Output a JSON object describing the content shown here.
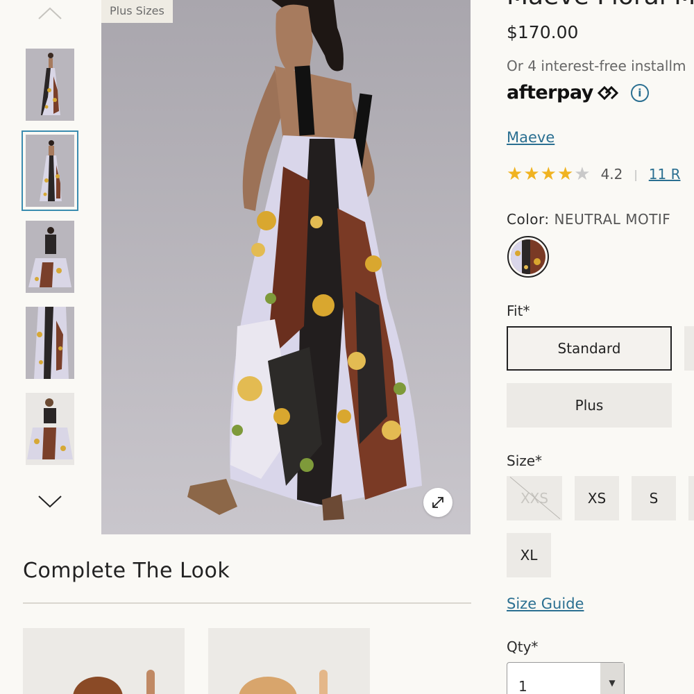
{
  "gallery": {
    "badge": "Plus Sizes",
    "selected_index": 1
  },
  "complete_the_look": {
    "title": "Complete The Look"
  },
  "product": {
    "title": "Maeve Floral M",
    "price": "$170.00",
    "installments_text": "Or 4 interest-free installm",
    "afterpay_logo": "afterpay",
    "brand": "Maeve",
    "rating": {
      "value": "4.2",
      "stars": 4.2,
      "reviews": "11 R"
    },
    "color": {
      "label": "Color:",
      "value": "NEUTRAL MOTIF"
    },
    "fit": {
      "label": "Fit*",
      "options": [
        "Standard",
        "Plus"
      ],
      "selected": "Standard"
    },
    "size": {
      "label": "Size*",
      "options": [
        "XXS",
        "XS",
        "S",
        "XL"
      ],
      "unavailable": [
        "XXS"
      ]
    },
    "size_guide": "Size Guide",
    "qty": {
      "label": "Qty*",
      "value": "1"
    }
  },
  "colors": {
    "link": "#2a6f91",
    "star": "#f0b321",
    "selected_thumb_border": "#3a8cb0",
    "page_bg": "#faf9f5"
  }
}
